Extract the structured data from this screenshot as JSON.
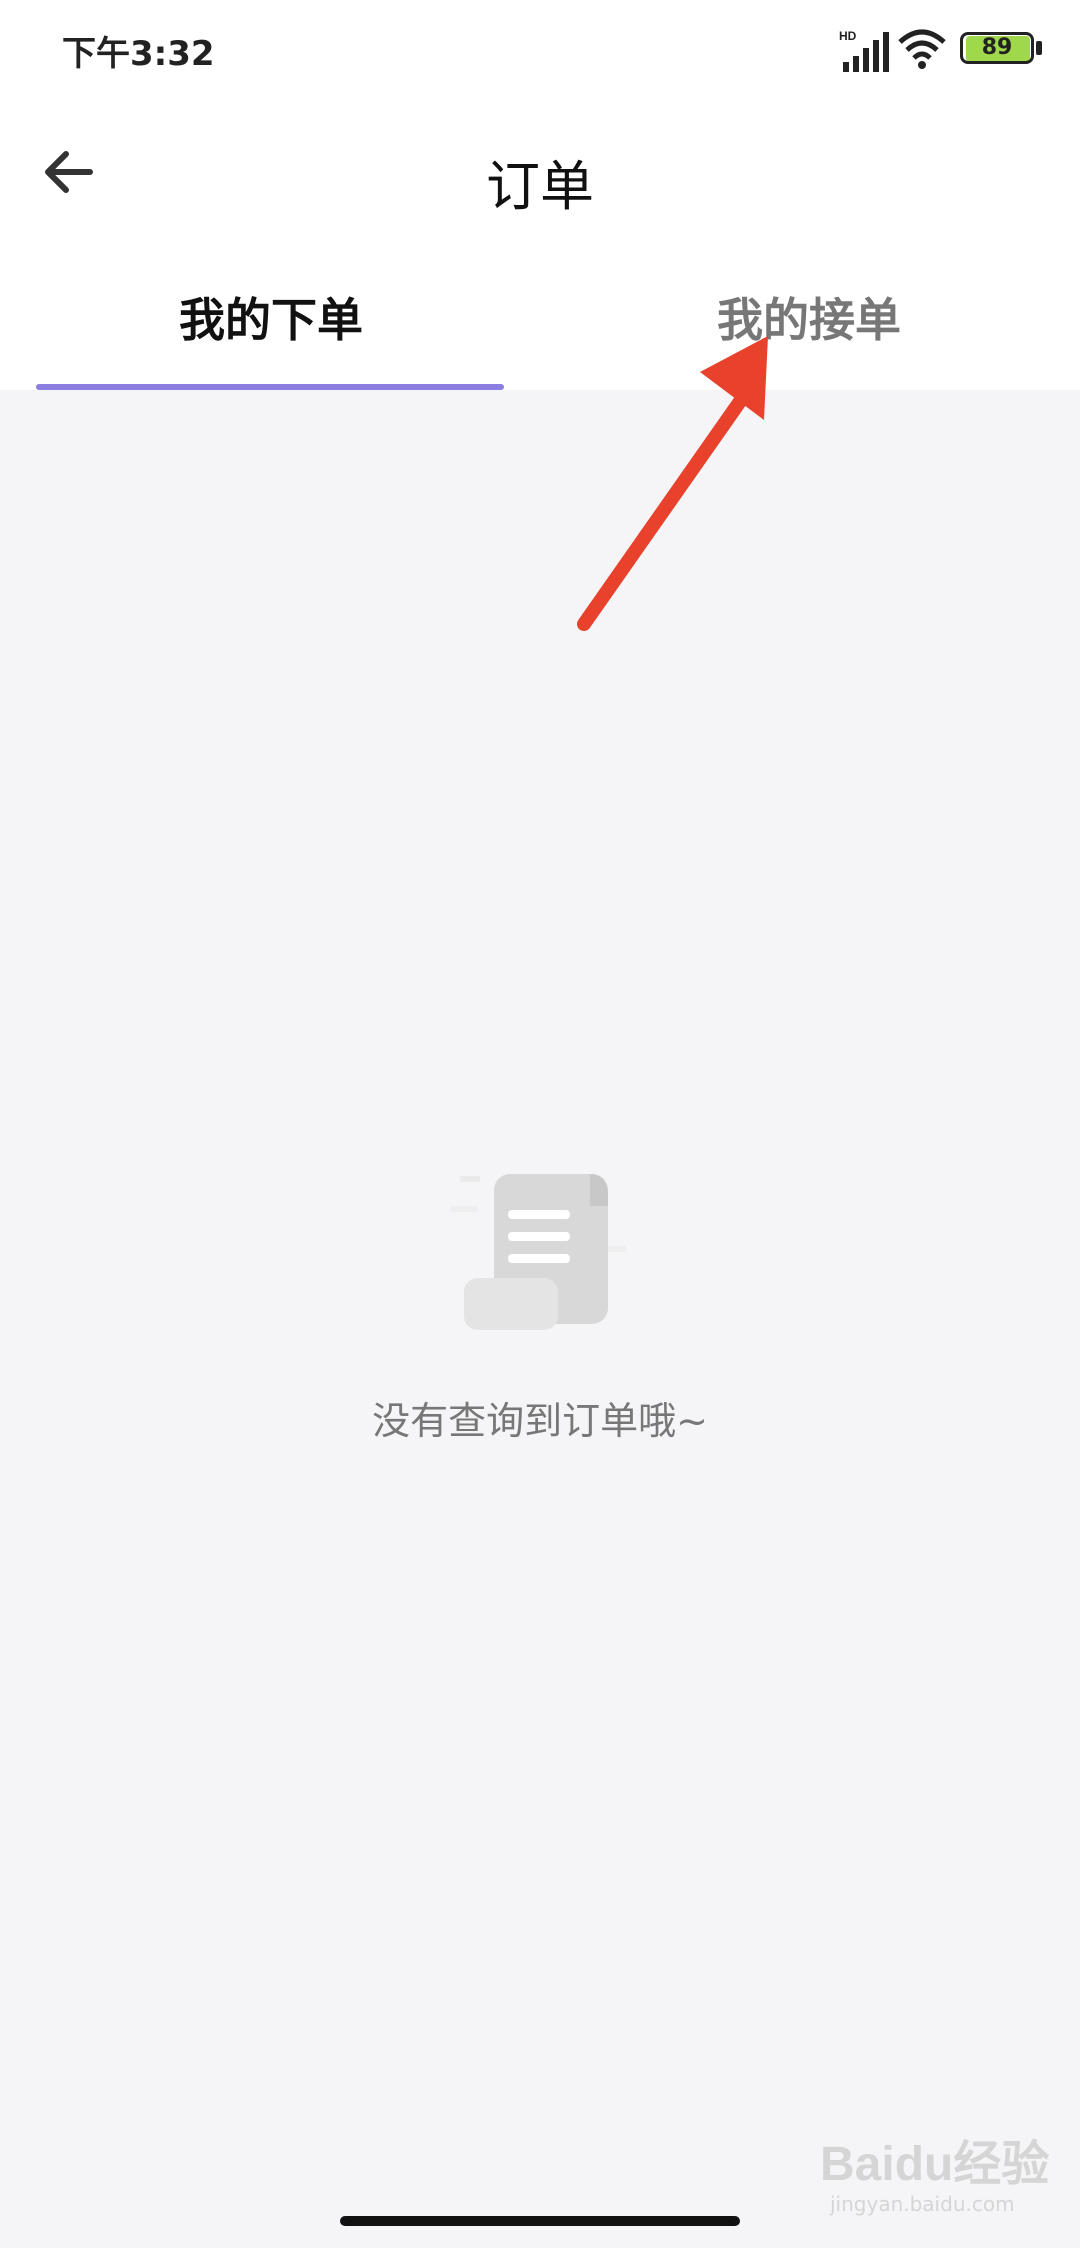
{
  "status_bar": {
    "time": "下午3:32",
    "network_label": "HD",
    "battery_level": "89",
    "icons": [
      "signal-icon",
      "wifi-icon",
      "battery-icon"
    ]
  },
  "header": {
    "title": "订单",
    "back_icon": "arrow-left-icon"
  },
  "tabs": [
    {
      "label": "我的下单",
      "active": true
    },
    {
      "label": "我的接单",
      "active": false
    }
  ],
  "empty_state": {
    "icon": "scroll-document-icon",
    "message": "没有查询到订单哦~"
  },
  "annotation": {
    "arrow_color": "#e8412c",
    "points_to": "我的接单"
  },
  "watermark": {
    "logo": "Baidu经验",
    "sub": "jingyan.baidu.com"
  },
  "colors": {
    "tab_indicator": "#8c7ee0",
    "background": "#f5f5f7"
  }
}
